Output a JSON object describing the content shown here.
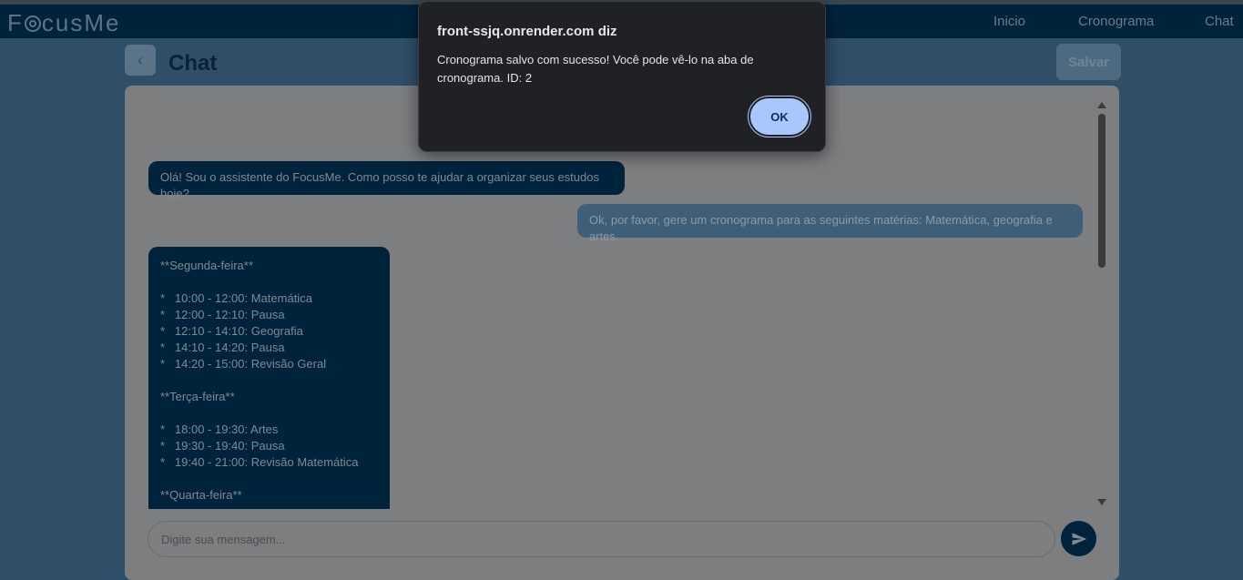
{
  "app": {
    "logo": {
      "pre": "F",
      "post": "cusMe"
    },
    "nav": [
      "Inicio",
      "Cronograma",
      "Chat"
    ]
  },
  "header": {
    "title": "Chat",
    "save_label": "Salvar",
    "back_glyph": "‹"
  },
  "chat": {
    "messages": [
      {
        "role": "bot",
        "text": "Olá! Sou o assistente do FocusMe. Como posso te ajudar a organizar seus estudos hoje?"
      },
      {
        "role": "user",
        "text": "Ok, por favor, gere um cronograma para as seguintes matérias: Matemática, geografia e artes."
      },
      {
        "role": "bot",
        "lines": [
          "**Segunda-feira**",
          "",
          "*   10:00 - 12:00: Matemática",
          "*   12:00 - 12:10: Pausa",
          "*   12:10 - 14:10: Geografia",
          "*   14:10 - 14:20: Pausa",
          "*   14:20 - 15:00: Revisão Geral",
          "",
          "**Terça-feira**",
          "",
          "*   18:00 - 19:30: Artes",
          "*   19:30 - 19:40: Pausa",
          "*   19:40 - 21:00: Revisão Matemática",
          "",
          "**Quarta-feira**"
        ]
      }
    ],
    "input_placeholder": "Digite sua mensagem..."
  },
  "dialog": {
    "title": "front-ssjq.onrender.com diz",
    "message": "Cronograma salvo com sucesso! Você pode vê-lo na aba de cronograma. ID: 2",
    "ok_label": "OK"
  },
  "colors": {
    "navbar": "#00233c",
    "bot_bubble": "#00233c",
    "user_bubble": "#3f5f78",
    "dialog_bg": "#1f2125",
    "ok_button": "#a9c7fb"
  },
  "icons": {
    "send": "send-icon",
    "back": "chevron-left-icon",
    "logo_target": "target-icon"
  }
}
